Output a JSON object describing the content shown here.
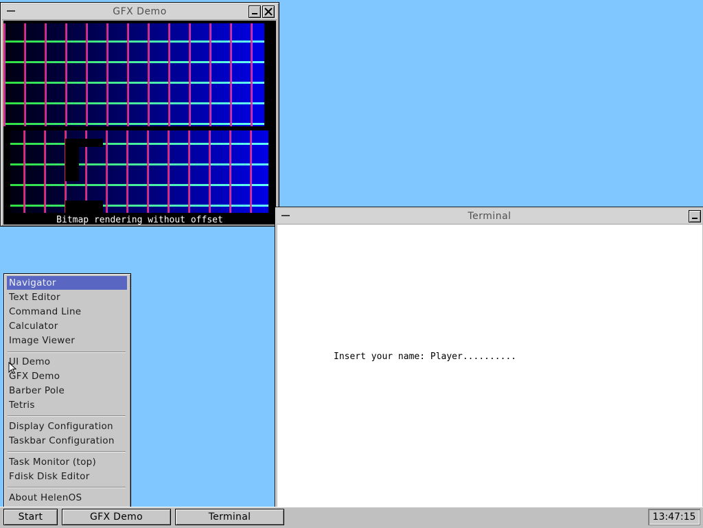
{
  "gfx_window": {
    "title": "GFX Demo",
    "status_text": "Bitmap rendering without offset"
  },
  "terminal_window": {
    "title": "Terminal",
    "line": "Insert your name: Player.........."
  },
  "start_menu": {
    "items": [
      {
        "label": "Navigator",
        "selected": true
      },
      {
        "label": "Text Editor"
      },
      {
        "label": "Command Line"
      },
      {
        "label": "Calculator"
      },
      {
        "label": "Image Viewer"
      },
      {
        "label": "UI Demo"
      },
      {
        "label": "GFX Demo"
      },
      {
        "label": "Barber Pole"
      },
      {
        "label": "Tetris"
      },
      {
        "label": "Display Configuration"
      },
      {
        "label": "Taskbar Configuration"
      },
      {
        "label": "Task Monitor (top)"
      },
      {
        "label": "Fdisk Disk Editor"
      },
      {
        "label": "About HelenOS"
      }
    ]
  },
  "taskbar": {
    "start_label": "Start",
    "buttons": [
      "GFX Demo",
      "Terminal"
    ],
    "clock": "13:47:15"
  },
  "colors": {
    "desktop": "#80c6ff",
    "menu_highlight": "#5a67c2",
    "grid_horizontal": "#40ff80",
    "grid_vertical": "#ff3070"
  }
}
